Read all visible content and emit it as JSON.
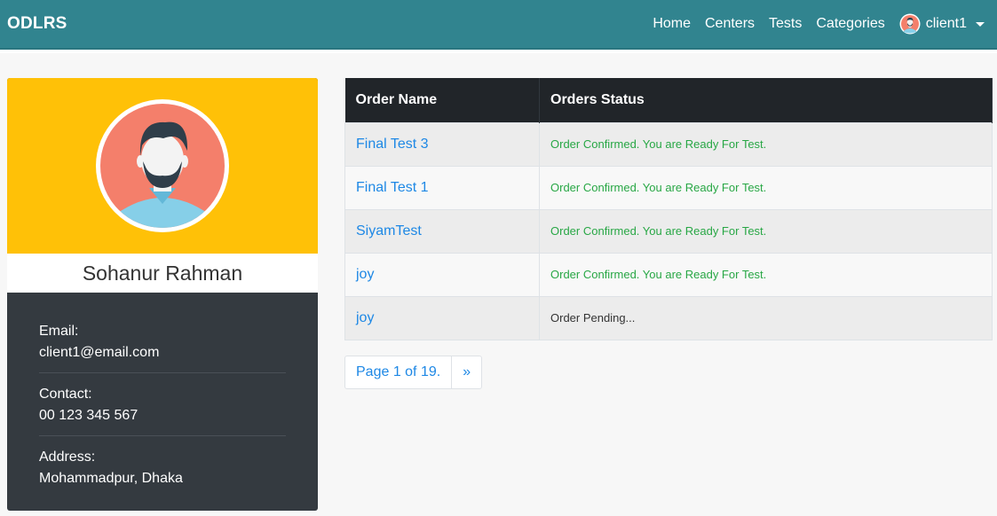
{
  "navbar": {
    "brand": "ODLRS",
    "links": [
      "Home",
      "Centers",
      "Tests",
      "Categories"
    ],
    "user": "client1"
  },
  "profile": {
    "name": "Sohanur Rahman",
    "email_label": "Email:",
    "email": "client1@email.com",
    "contact_label": "Contact:",
    "contact": "00 123 345 567",
    "address_label": "Address:",
    "address": "Mohammadpur, Dhaka"
  },
  "orders": {
    "headers": [
      "Order Name",
      "Orders Status"
    ],
    "rows": [
      {
        "name": "Final Test 3",
        "status": "Order Confirmed. You are Ready For Test."
      },
      {
        "name": "Final Test 1",
        "status": "Order Confirmed. You are Ready For Test."
      },
      {
        "name": "SiyamTest",
        "status": "Order Confirmed. You are Ready For Test."
      },
      {
        "name": "joy",
        "status": "Order Confirmed. You are Ready For Test."
      },
      {
        "name": "joy",
        "status": "Order Pending..."
      }
    ]
  },
  "pagination": {
    "page_text": "Page 1 of 19.",
    "next": "»"
  },
  "colors": {
    "navbar": "#31848f",
    "profile_header": "#ffc107",
    "profile_body": "#343a40",
    "link": "#1e88e5",
    "confirmed": "#28a745"
  },
  "icons": {
    "user_avatar": "user-avatar-icon",
    "dropdown": "caret-down-icon"
  }
}
